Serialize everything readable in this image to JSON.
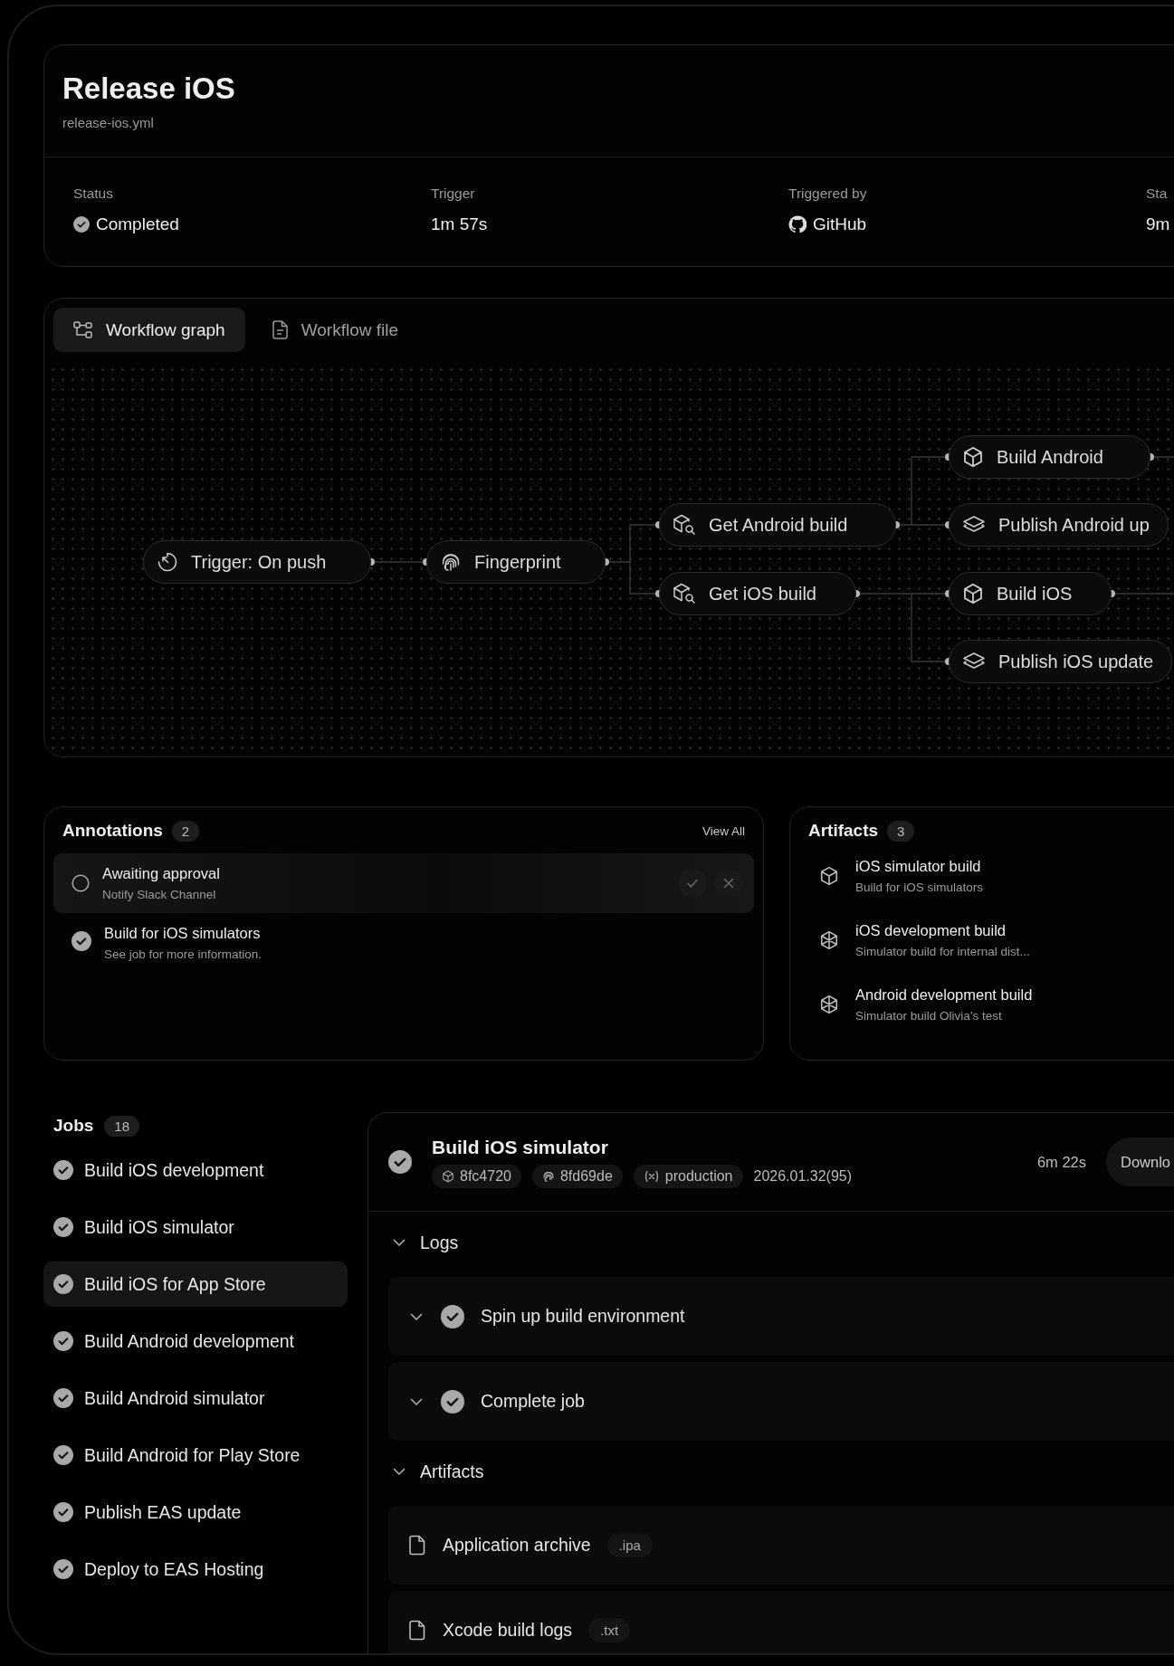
{
  "workflow": {
    "title": "Release iOS",
    "file": "release-ios.yml"
  },
  "stats": [
    {
      "label": "Status",
      "value": "Completed",
      "kind": "status"
    },
    {
      "label": "Trigger",
      "value": "1m 57s",
      "kind": "plain"
    },
    {
      "label": "Triggered by",
      "value": "GitHub",
      "kind": "source"
    },
    {
      "label": "Sta",
      "value": "9m",
      "kind": "plain"
    }
  ],
  "tabs": [
    {
      "label": "Workflow graph",
      "selected": true,
      "kind": "graph"
    },
    {
      "label": "Workflow file",
      "selected": false,
      "kind": "file"
    }
  ],
  "graph": {
    "nodes": [
      {
        "label": "Trigger: On push",
        "kind": "trigger"
      },
      {
        "label": "Fingerprint",
        "kind": "fingerprint"
      },
      {
        "label": "Get Android build",
        "kind": "fetch"
      },
      {
        "label": "Get iOS build",
        "kind": "fetch"
      },
      {
        "label": "Build Android",
        "kind": "build"
      },
      {
        "label": "Publish Android up",
        "kind": "publish"
      },
      {
        "label": "Build iOS",
        "kind": "build"
      },
      {
        "label": "Publish iOS update",
        "kind": "publish"
      }
    ]
  },
  "annotations": {
    "title": "Annotations",
    "count": "2",
    "view_all": "View All",
    "items": [
      {
        "title": "Awaiting approval",
        "subtitle": "Notify Slack Channel",
        "done": false
      },
      {
        "title": "Build for iOS simulators",
        "subtitle": "See job for more information.",
        "done": true
      }
    ]
  },
  "artifacts": {
    "title": "Artifacts",
    "count": "3",
    "items": [
      {
        "name": "iOS simulator build",
        "description": "Build for iOS simulators",
        "kind": "cube"
      },
      {
        "name": "iOS development build",
        "description": "Simulator build for internal dist...",
        "kind": "sphere"
      },
      {
        "name": "Android development build",
        "description": "Simulator build Olivia’s test",
        "kind": "sphere"
      }
    ]
  },
  "jobs": {
    "title": "Jobs",
    "count": "18",
    "items": [
      {
        "label": "Build iOS development",
        "selected": false
      },
      {
        "label": "Build iOS simulator",
        "selected": false
      },
      {
        "label": "Build iOS for App Store",
        "selected": true
      },
      {
        "label": "Build Android development",
        "selected": false
      },
      {
        "label": "Build Android simulator",
        "selected": false
      },
      {
        "label": "Build Android for Play Store",
        "selected": false
      },
      {
        "label": "Publish EAS update",
        "selected": false
      },
      {
        "label": "Deploy to EAS Hosting",
        "selected": false
      }
    ]
  },
  "job_detail": {
    "title": "Build iOS simulator",
    "tags": [
      {
        "kind": "commit",
        "text": "8fc4720"
      },
      {
        "kind": "fingerprint",
        "text": "8fd69de"
      },
      {
        "kind": "env",
        "text": "production"
      }
    ],
    "version": "2026.01.32(95)",
    "duration": "6m 22s",
    "download": "Downlo",
    "sections": [
      {
        "title": "Logs",
        "expanded": true,
        "kind": "logs",
        "items": [
          {
            "label": "Spin up build environment"
          },
          {
            "label": "Complete job"
          }
        ]
      },
      {
        "title": "Artifacts",
        "expanded": true,
        "kind": "files",
        "items": [
          {
            "label": "Application archive",
            "ext": ".ipa"
          },
          {
            "label": "Xcode build logs",
            "ext": ".txt"
          }
        ]
      }
    ]
  }
}
